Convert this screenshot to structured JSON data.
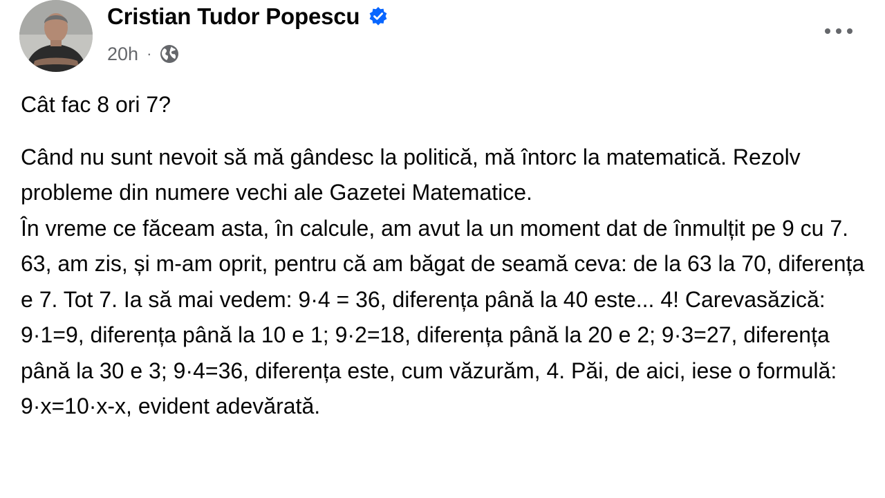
{
  "author": {
    "name": "Cristian Tudor Popescu",
    "verified_icon": "verified-badge-icon",
    "avatar_icon": "profile-photo"
  },
  "meta": {
    "time": "20h",
    "separator": "·",
    "audience_icon": "globe-icon"
  },
  "menu": {
    "more_icon": "more-options-icon"
  },
  "post": {
    "title": "Cât fac 8 ori 7?",
    "paragraph_1": " Când nu sunt nevoit să mă gândesc la politică, mă întorc la matematică. Rezolv probleme din numere vechi ale Gazetei Matematice.",
    "paragraph_2": " În vreme ce făceam asta, în calcule, am avut la un moment dat de înmulțit pe 9 cu 7. 63, am zis, și m-am oprit, pentru că am băgat de seamă ceva: de la 63 la 70, diferența e 7. Tot 7. Ia să mai vedem: 9·4 = 36, diferența până la 40 este... 4! Carevasăzică: 9·1=9, diferența până la 10 e 1; 9·2=18, diferența până la 20 e 2; 9·3=27, diferența până la 30 e 3; 9·4=36, diferența este, cum văzurăm, 4. Păi, de aici, iese o formulă: 9·x=10·x-x, evident adevărată."
  },
  "colors": {
    "text": "#050505",
    "secondary": "#65676b",
    "verified": "#0866ff"
  }
}
